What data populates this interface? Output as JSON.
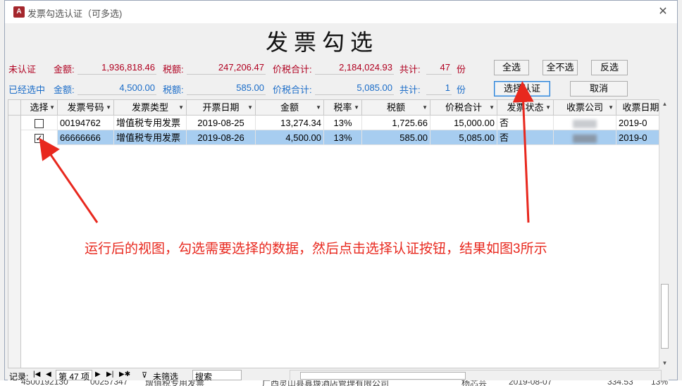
{
  "window": {
    "title": "发票勾选认证（可多选)",
    "heading": "发票勾选",
    "app_icon_letter": "A"
  },
  "unverified": {
    "label": "未认证",
    "amount_label": "金额:",
    "amount": "1,936,818.46",
    "tax_label": "税额:",
    "tax": "247,206.47",
    "total_label": "价税合计:",
    "total": "2,184,024.93",
    "count_label": "共计:",
    "count": "47",
    "unit": "份"
  },
  "selected": {
    "label": "已经选中",
    "amount_label": "金额:",
    "amount": "4,500.00",
    "tax_label": "税额:",
    "tax": "585.00",
    "total_label": "价税合计:",
    "total": "5,085.00",
    "count_label": "共计:",
    "count": "1",
    "unit": "份"
  },
  "buttons": {
    "select_all": "全选",
    "select_none": "全不选",
    "invert": "反选",
    "verify": "选择认证",
    "cancel": "取消"
  },
  "grid": {
    "headers": [
      "选择",
      "发票号码",
      "发票类型",
      "开票日期",
      "金额",
      "税率",
      "税额",
      "价税合计",
      "发票状态",
      "收票公司",
      "收票日期"
    ],
    "rows": [
      {
        "checked": false,
        "number": "00194762",
        "type": "增值税专用发票",
        "date": "2019-08-25",
        "amount": "13,274.34",
        "rate": "13%",
        "tax": "1,725.66",
        "total": "15,000.00",
        "status": "否",
        "recv_date": "2019-0"
      },
      {
        "checked": true,
        "number": "66666666",
        "type": "增值税专用发票",
        "date": "2019-08-26",
        "amount": "4,500.00",
        "rate": "13%",
        "tax": "585.00",
        "total": "5,085.00",
        "status": "否",
        "recv_date": "2019-0"
      }
    ]
  },
  "navbar": {
    "record_label": "记录:",
    "position": "第 47 项",
    "filter": "未筛选",
    "search": "搜索"
  },
  "annotation": "运行后的视图，勾选需要选择的数据，然后点击选择认证按钮，结果如图3所示",
  "background_row": {
    "c1": "4500192130",
    "c2": "00257347",
    "c3": "增值税专用发票",
    "c4": "广西灵山县真焕酒店管理有限公司",
    "c5": "杨芯芸",
    "c6": "2019-08-07",
    "c7": "334.53",
    "c8": "13%"
  },
  "colors": {
    "unverified": "#b00020",
    "selected": "#1a6cc8",
    "annotation": "#e8281e",
    "row_highlight": "#a7cdf0"
  }
}
